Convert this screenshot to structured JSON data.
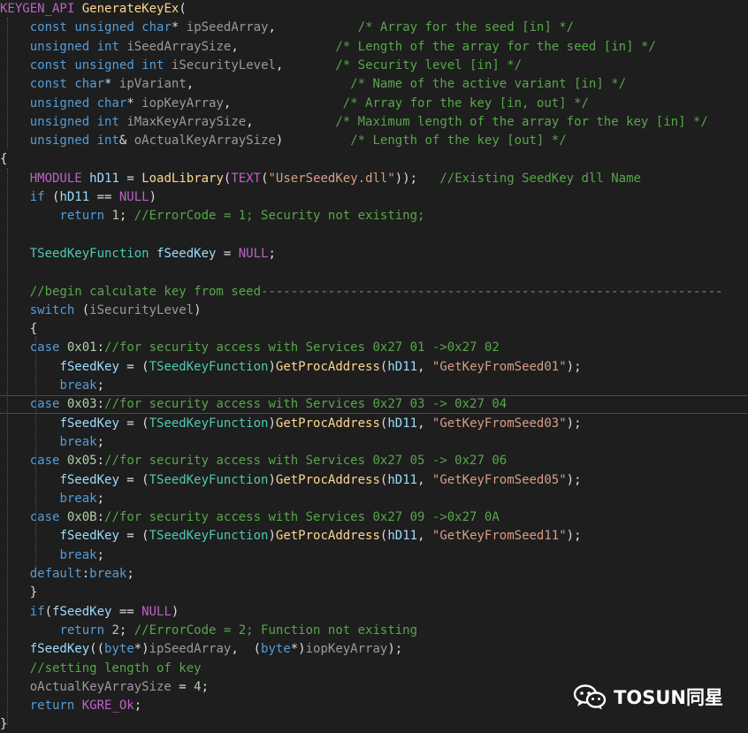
{
  "colors": {
    "background": "#1e1e1e",
    "keyword": "#569cd6",
    "identifier": "#dcdcdc",
    "macro": "#bd63c5",
    "comment": "#57a64a",
    "string": "#d69d85",
    "number": "#b5cea8",
    "type": "#4ec9b0",
    "function": "#ffd68f",
    "local": "#9cdcfe",
    "param": "#9a9a9a"
  },
  "code": {
    "lines": [
      [
        [
          "macro",
          "KEYGEN_API"
        ],
        [
          "ident",
          " "
        ],
        [
          "func",
          "GenerateKeyEx"
        ],
        [
          "ident",
          "("
        ]
      ],
      [
        [
          "ident",
          "    "
        ],
        [
          "kw",
          "const"
        ],
        [
          "ident",
          " "
        ],
        [
          "kw",
          "unsigned"
        ],
        [
          "ident",
          " "
        ],
        [
          "kw",
          "char"
        ],
        [
          "ident",
          "* "
        ],
        [
          "param",
          "ipSeedArray"
        ],
        [
          "ident",
          ",           "
        ],
        [
          "comment",
          "/* Array for the seed [in] */"
        ]
      ],
      [
        [
          "ident",
          "    "
        ],
        [
          "kw",
          "unsigned"
        ],
        [
          "ident",
          " "
        ],
        [
          "kw",
          "int"
        ],
        [
          "ident",
          " "
        ],
        [
          "param",
          "iSeedArraySize"
        ],
        [
          "ident",
          ",             "
        ],
        [
          "comment",
          "/* Length of the array for the seed [in] */"
        ]
      ],
      [
        [
          "ident",
          "    "
        ],
        [
          "kw",
          "const"
        ],
        [
          "ident",
          " "
        ],
        [
          "kw",
          "unsigned"
        ],
        [
          "ident",
          " "
        ],
        [
          "kw",
          "int"
        ],
        [
          "ident",
          " "
        ],
        [
          "param",
          "iSecurityLevel"
        ],
        [
          "ident",
          ",       "
        ],
        [
          "comment",
          "/* Security level [in] */"
        ]
      ],
      [
        [
          "ident",
          "    "
        ],
        [
          "kw",
          "const"
        ],
        [
          "ident",
          " "
        ],
        [
          "kw",
          "char"
        ],
        [
          "ident",
          "* "
        ],
        [
          "param",
          "ipVariant"
        ],
        [
          "ident",
          ",                     "
        ],
        [
          "comment",
          "/* Name of the active variant [in] */"
        ]
      ],
      [
        [
          "ident",
          "    "
        ],
        [
          "kw",
          "unsigned"
        ],
        [
          "ident",
          " "
        ],
        [
          "kw",
          "char"
        ],
        [
          "ident",
          "* "
        ],
        [
          "param",
          "iopKeyArray"
        ],
        [
          "ident",
          ",               "
        ],
        [
          "comment",
          "/* Array for the key [in, out] */"
        ]
      ],
      [
        [
          "ident",
          "    "
        ],
        [
          "kw",
          "unsigned"
        ],
        [
          "ident",
          " "
        ],
        [
          "kw",
          "int"
        ],
        [
          "ident",
          " "
        ],
        [
          "param",
          "iMaxKeyArraySize"
        ],
        [
          "ident",
          ",           "
        ],
        [
          "comment",
          "/* Maximum length of the array for the key [in] */"
        ]
      ],
      [
        [
          "ident",
          "    "
        ],
        [
          "kw",
          "unsigned"
        ],
        [
          "ident",
          " "
        ],
        [
          "kw",
          "int"
        ],
        [
          "ident",
          "& "
        ],
        [
          "param",
          "oActualKeyArraySize"
        ],
        [
          "ident",
          ")         "
        ],
        [
          "comment",
          "/* Length of the key [out] */"
        ]
      ],
      [
        [
          "ident",
          "{"
        ]
      ],
      [
        [
          "ident",
          "    "
        ],
        [
          "macro",
          "HMODULE"
        ],
        [
          "ident",
          " "
        ],
        [
          "local",
          "hD11"
        ],
        [
          "ident",
          " = "
        ],
        [
          "func",
          "LoadLibrary"
        ],
        [
          "ident",
          "("
        ],
        [
          "macro",
          "TEXT"
        ],
        [
          "ident",
          "("
        ],
        [
          "string",
          "\"UserSeedKey.dll\""
        ],
        [
          "ident",
          "));   "
        ],
        [
          "comment",
          "//Existing SeedKey dll Name"
        ]
      ],
      [
        [
          "ident",
          "    "
        ],
        [
          "kw",
          "if"
        ],
        [
          "ident",
          " ("
        ],
        [
          "local",
          "hD11"
        ],
        [
          "ident",
          " == "
        ],
        [
          "macro",
          "NULL"
        ],
        [
          "ident",
          ")"
        ]
      ],
      [
        [
          "ident",
          "        "
        ],
        [
          "kw",
          "return"
        ],
        [
          "ident",
          " "
        ],
        [
          "num",
          "1"
        ],
        [
          "ident",
          "; "
        ],
        [
          "comment",
          "//ErrorCode = 1; Security not existing;"
        ]
      ],
      [],
      [
        [
          "ident",
          "    "
        ],
        [
          "type",
          "TSeedKeyFunction"
        ],
        [
          "ident",
          " "
        ],
        [
          "local",
          "fSeedKey"
        ],
        [
          "ident",
          " = "
        ],
        [
          "macro",
          "NULL"
        ],
        [
          "ident",
          ";"
        ]
      ],
      [],
      [
        [
          "ident",
          "    "
        ],
        [
          "comment",
          "//begin calculate key from seed--------------------------------------------------------------"
        ]
      ],
      [
        [
          "ident",
          "    "
        ],
        [
          "kw",
          "switch"
        ],
        [
          "ident",
          " ("
        ],
        [
          "param",
          "iSecurityLevel"
        ],
        [
          "ident",
          ")"
        ]
      ],
      [
        [
          "ident",
          "    {"
        ]
      ],
      [
        [
          "ident",
          "    "
        ],
        [
          "kw",
          "case"
        ],
        [
          "ident",
          " "
        ],
        [
          "num",
          "0x01"
        ],
        [
          "ident",
          ":"
        ],
        [
          "comment",
          "//for security access with Services 0x27 01 ->0x27 02"
        ]
      ],
      [
        [
          "ident",
          "        "
        ],
        [
          "local",
          "fSeedKey"
        ],
        [
          "ident",
          " = ("
        ],
        [
          "type",
          "TSeedKeyFunction"
        ],
        [
          "ident",
          ")"
        ],
        [
          "func",
          "GetProcAddress"
        ],
        [
          "ident",
          "("
        ],
        [
          "local",
          "hD11"
        ],
        [
          "ident",
          ", "
        ],
        [
          "string",
          "\"GetKeyFromSeed01\""
        ],
        [
          "ident",
          ");"
        ]
      ],
      [
        [
          "ident",
          "        "
        ],
        [
          "kw",
          "break"
        ],
        [
          "ident",
          ";"
        ]
      ],
      [
        [
          "ident",
          "    "
        ],
        [
          "kw",
          "case"
        ],
        [
          "ident",
          " "
        ],
        [
          "num",
          "0x03"
        ],
        [
          "ident",
          ":"
        ],
        [
          "comment",
          "//for security access with Services 0x27 03 -> 0x27 04"
        ]
      ],
      [
        [
          "ident",
          "        "
        ],
        [
          "local",
          "fSeedKey"
        ],
        [
          "ident",
          " = ("
        ],
        [
          "type",
          "TSeedKeyFunction"
        ],
        [
          "ident",
          ")"
        ],
        [
          "func",
          "GetProcAddress"
        ],
        [
          "ident",
          "("
        ],
        [
          "local",
          "hD11"
        ],
        [
          "ident",
          ", "
        ],
        [
          "string",
          "\"GetKeyFromSeed03\""
        ],
        [
          "ident",
          ");"
        ]
      ],
      [
        [
          "ident",
          "        "
        ],
        [
          "kw",
          "break"
        ],
        [
          "ident",
          ";"
        ]
      ],
      [
        [
          "ident",
          "    "
        ],
        [
          "kw",
          "case"
        ],
        [
          "ident",
          " "
        ],
        [
          "num",
          "0x05"
        ],
        [
          "ident",
          ":"
        ],
        [
          "comment",
          "//for security access with Services 0x27 05 -> 0x27 06"
        ]
      ],
      [
        [
          "ident",
          "        "
        ],
        [
          "local",
          "fSeedKey"
        ],
        [
          "ident",
          " = ("
        ],
        [
          "type",
          "TSeedKeyFunction"
        ],
        [
          "ident",
          ")"
        ],
        [
          "func",
          "GetProcAddress"
        ],
        [
          "ident",
          "("
        ],
        [
          "local",
          "hD11"
        ],
        [
          "ident",
          ", "
        ],
        [
          "string",
          "\"GetKeyFromSeed05\""
        ],
        [
          "ident",
          ");"
        ]
      ],
      [
        [
          "ident",
          "        "
        ],
        [
          "kw",
          "break"
        ],
        [
          "ident",
          ";"
        ]
      ],
      [
        [
          "ident",
          "    "
        ],
        [
          "kw",
          "case"
        ],
        [
          "ident",
          " "
        ],
        [
          "num",
          "0x0B"
        ],
        [
          "ident",
          ":"
        ],
        [
          "comment",
          "//for security access with Services 0x27 09 ->0x27 0A"
        ]
      ],
      [
        [
          "ident",
          "        "
        ],
        [
          "local",
          "fSeedKey"
        ],
        [
          "ident",
          " = ("
        ],
        [
          "type",
          "TSeedKeyFunction"
        ],
        [
          "ident",
          ")"
        ],
        [
          "func",
          "GetProcAddress"
        ],
        [
          "ident",
          "("
        ],
        [
          "local",
          "hD11"
        ],
        [
          "ident",
          ", "
        ],
        [
          "string",
          "\"GetKeyFromSeed11\""
        ],
        [
          "ident",
          ");"
        ]
      ],
      [
        [
          "ident",
          "        "
        ],
        [
          "kw",
          "break"
        ],
        [
          "ident",
          ";"
        ]
      ],
      [
        [
          "ident",
          "    "
        ],
        [
          "kw",
          "default"
        ],
        [
          "ident",
          ":"
        ],
        [
          "kw",
          "break"
        ],
        [
          "ident",
          ";"
        ]
      ],
      [
        [
          "ident",
          "    }"
        ]
      ],
      [
        [
          "ident",
          "    "
        ],
        [
          "kw",
          "if"
        ],
        [
          "ident",
          "("
        ],
        [
          "local",
          "fSeedKey"
        ],
        [
          "ident",
          " == "
        ],
        [
          "macro",
          "NULL"
        ],
        [
          "ident",
          ")"
        ]
      ],
      [
        [
          "ident",
          "        "
        ],
        [
          "kw",
          "return"
        ],
        [
          "ident",
          " "
        ],
        [
          "num",
          "2"
        ],
        [
          "ident",
          "; "
        ],
        [
          "comment",
          "//ErrorCode = 2; Function not existing"
        ]
      ],
      [
        [
          "ident",
          "    "
        ],
        [
          "local",
          "fSeedKey"
        ],
        [
          "ident",
          "(("
        ],
        [
          "kw",
          "byte"
        ],
        [
          "ident",
          "*)"
        ],
        [
          "param",
          "ipSeedArray"
        ],
        [
          "ident",
          ",  ("
        ],
        [
          "kw",
          "byte"
        ],
        [
          "ident",
          "*)"
        ],
        [
          "param",
          "iopKeyArray"
        ],
        [
          "ident",
          ");"
        ]
      ],
      [
        [
          "ident",
          "    "
        ],
        [
          "comment",
          "//setting length of key"
        ]
      ],
      [
        [
          "ident",
          "    "
        ],
        [
          "param",
          "oActualKeyArraySize"
        ],
        [
          "ident",
          " = "
        ],
        [
          "num",
          "4"
        ],
        [
          "ident",
          ";"
        ]
      ],
      [
        [
          "ident",
          "    "
        ],
        [
          "kw",
          "return"
        ],
        [
          "ident",
          " "
        ],
        [
          "macro",
          "KGRE_Ok"
        ],
        [
          "ident",
          ";"
        ]
      ],
      [
        [
          "ident",
          "}"
        ]
      ]
    ]
  },
  "watermark": {
    "text": "TOSUN同星",
    "icon": "wechat-icon"
  }
}
